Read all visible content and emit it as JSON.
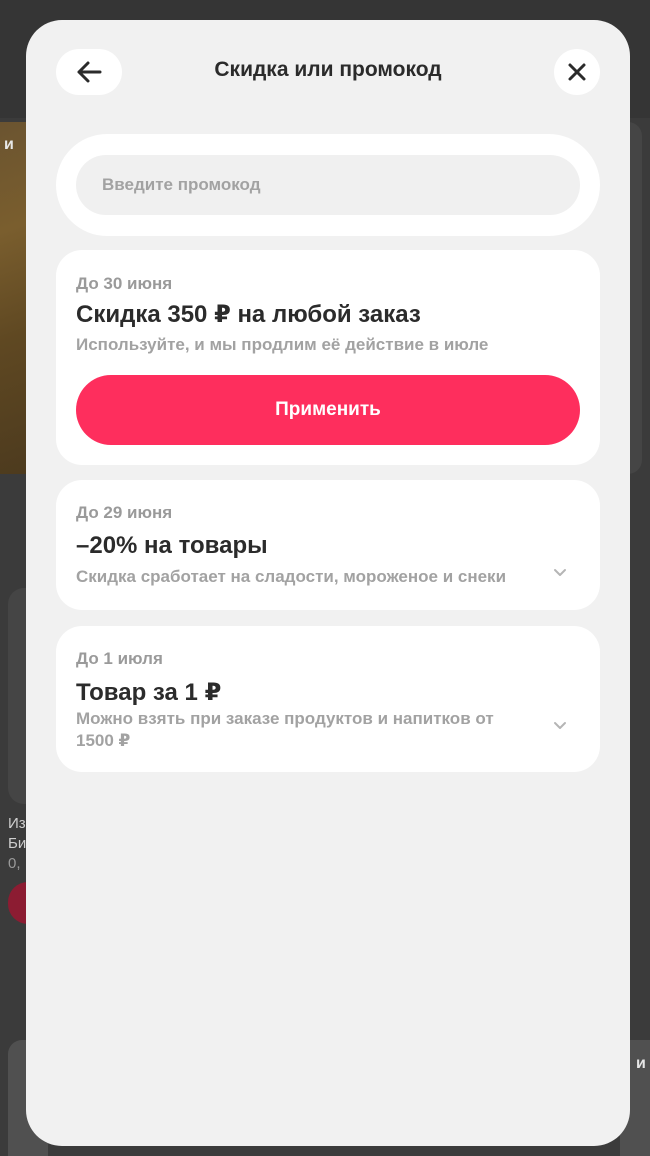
{
  "background": {
    "left_text_lines": [
      "Из",
      "Би",
      "0,"
    ],
    "left_top_label": "и",
    "right_bottom_label": "и"
  },
  "modal": {
    "title": "Скидка или промокод",
    "back_icon": "arrow-left-icon",
    "close_icon": "close-icon"
  },
  "promo": {
    "placeholder": "Введите промокод",
    "value": ""
  },
  "offers": [
    {
      "date": "До 30 июня",
      "title": "Скидка 350 ₽ на любой заказ",
      "description": "Используйте, и мы продлим её действие в июле",
      "button_label": "Применить"
    },
    {
      "date": "До 29 июня",
      "title": "–20% на товары",
      "description": "Скидка сработает на сладости, мороженое и снеки",
      "icon": "chevron-down-icon"
    },
    {
      "date": "До 1 июля",
      "title": "Товар за 1 ₽",
      "description_lines": [
        "Можно взять при заказе продуктов и напитков от",
        "1500 ₽"
      ],
      "icon": "chevron-down-icon"
    }
  ],
  "colors": {
    "accent": "#fe2e5d",
    "modal_bg": "#f1f1f1",
    "card_bg": "#ffffff",
    "overlay": "#3b3b3b"
  }
}
